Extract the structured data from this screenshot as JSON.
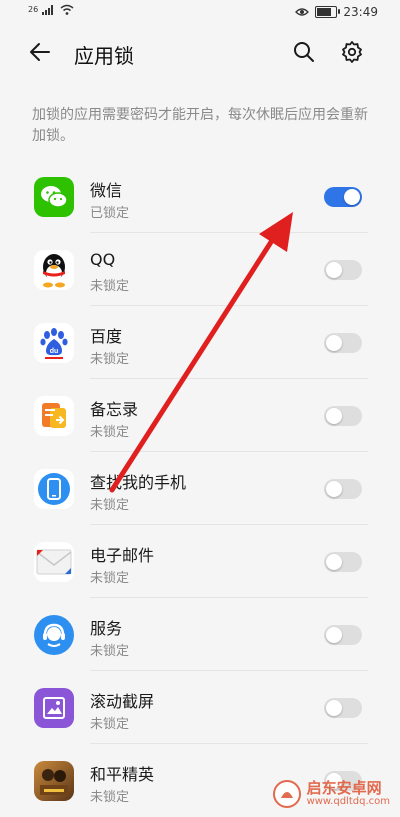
{
  "status_bar": {
    "signal": "26",
    "time": "23:49"
  },
  "header": {
    "title": "应用锁",
    "back_icon": "back-arrow-icon",
    "search_icon": "search-icon",
    "settings_icon": "gear-icon"
  },
  "description": "加锁的应用需要密码才能开启，每次休眠后应用会重新加锁。",
  "apps": [
    {
      "name": "微信",
      "status": "已锁定",
      "locked": true,
      "icon": "wechat-icon",
      "color": "#2dc100"
    },
    {
      "name": "QQ",
      "status": "未锁定",
      "locked": false,
      "icon": "qq-penguin-icon",
      "color": "#ffffff"
    },
    {
      "name": "百度",
      "status": "未锁定",
      "locked": false,
      "icon": "baidu-paw-icon",
      "color": "#2f5fe0"
    },
    {
      "name": "备忘录",
      "status": "未锁定",
      "locked": false,
      "icon": "memo-icon",
      "color": "#f7a020"
    },
    {
      "name": "查找我的手机",
      "status": "未锁定",
      "locked": false,
      "icon": "find-phone-icon",
      "color": "#2d8ff0"
    },
    {
      "name": "电子邮件",
      "status": "未锁定",
      "locked": false,
      "icon": "mail-icon",
      "color": "#e8e8e8"
    },
    {
      "name": "服务",
      "status": "未锁定",
      "locked": false,
      "icon": "service-headset-icon",
      "color": "#2d8ff0"
    },
    {
      "name": "滚动截屏",
      "status": "未锁定",
      "locked": false,
      "icon": "scroll-screenshot-icon",
      "color": "#8b55d8"
    },
    {
      "name": "和平精英",
      "status": "未锁定",
      "locked": false,
      "icon": "game-icon",
      "color": "#8a5a2a"
    }
  ],
  "watermark": {
    "title": "启东安卓网",
    "url": "www.qdltdq.com"
  },
  "colors": {
    "accent": "#2f75e8",
    "annotation_arrow": "#e0201e"
  }
}
